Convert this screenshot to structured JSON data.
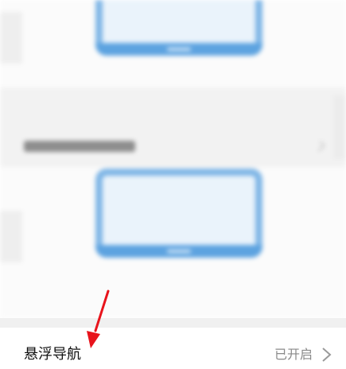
{
  "setting_row": {
    "label": "悬浮导航",
    "status": "已开启",
    "chevron_icon": "chevron-right-icon"
  },
  "annotation": {
    "icon": "red-arrow-icon",
    "color": "#e8141c"
  },
  "colors": {
    "phone_illustration": "#7fb6e6",
    "status_text": "#8a8a8a",
    "label_text": "#111111"
  }
}
